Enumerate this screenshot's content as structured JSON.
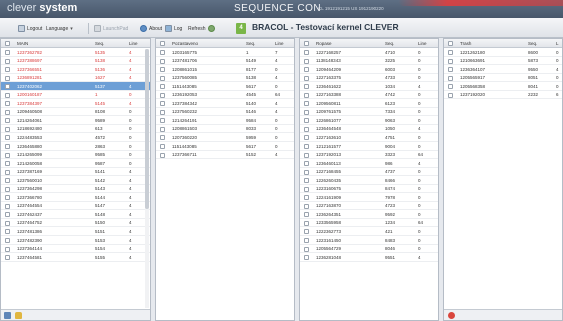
{
  "app": {
    "logo_part1": "clever",
    "logo_part2": "system",
    "title": "SEQUENCE CON",
    "ids": "CL 1912191215  US 1912190220"
  },
  "toolbar": {
    "logout": "Logout",
    "language": "Language",
    "launchpad": "LaunchPad",
    "about": "About",
    "log": "Log",
    "refresh": "Refresh",
    "counter": "4",
    "main_title": "BRACOL - Testovací kernel CLEVER"
  },
  "colors": {
    "accent_red": "#d83a3a",
    "selected": "#6d9fd6",
    "counter_green": "#7ab648"
  },
  "panels": {
    "main": {
      "headers": [
        "MAIN",
        "Seq.",
        "Line"
      ],
      "rows": [
        {
          "id": "1237362782",
          "seq": "5135",
          "line": "4",
          "state": "red"
        },
        {
          "id": "1237388697",
          "seq": "5138",
          "line": "4",
          "state": "red"
        },
        {
          "id": "1237366551",
          "seq": "5136",
          "line": "4",
          "state": "red"
        },
        {
          "id": "1236891281",
          "seq": "1627",
          "line": "4",
          "state": "red"
        },
        {
          "id": "1237402062",
          "seq": "5137",
          "line": "4",
          "state": "sel"
        },
        {
          "id": "1200160187",
          "seq": "1",
          "line": "0",
          "state": "red"
        },
        {
          "id": "1237384397",
          "seq": "5145",
          "line": "4",
          "state": "red"
        },
        {
          "id": "1209460508",
          "seq": "8108",
          "line": "0",
          "state": ""
        },
        {
          "id": "1214264061",
          "seq": "9589",
          "line": "0",
          "state": ""
        },
        {
          "id": "1218692480",
          "seq": "613",
          "line": "0",
          "state": ""
        },
        {
          "id": "1224483553",
          "seq": "4572",
          "line": "0",
          "state": ""
        },
        {
          "id": "1236465880",
          "seq": "2863",
          "line": "0",
          "state": ""
        },
        {
          "id": "1214265099",
          "seq": "9585",
          "line": "0",
          "state": ""
        },
        {
          "id": "1214260058",
          "seq": "9587",
          "line": "0",
          "state": ""
        },
        {
          "id": "1237387169",
          "seq": "5141",
          "line": "4",
          "state": ""
        },
        {
          "id": "1237560010",
          "seq": "5142",
          "line": "4",
          "state": ""
        },
        {
          "id": "1237364298",
          "seq": "5143",
          "line": "4",
          "state": ""
        },
        {
          "id": "1237366780",
          "seq": "5144",
          "line": "4",
          "state": ""
        },
        {
          "id": "1237464554",
          "seq": "5147",
          "line": "4",
          "state": ""
        },
        {
          "id": "1237462437",
          "seq": "5148",
          "line": "4",
          "state": ""
        },
        {
          "id": "1237464752",
          "seq": "5150",
          "line": "4",
          "state": ""
        },
        {
          "id": "1237481386",
          "seq": "5151",
          "line": "4",
          "state": ""
        },
        {
          "id": "1237482390",
          "seq": "5153",
          "line": "4",
          "state": ""
        },
        {
          "id": "1237364144",
          "seq": "5154",
          "line": "4",
          "state": ""
        },
        {
          "id": "1237464581",
          "seq": "5155",
          "line": "4",
          "state": ""
        }
      ]
    },
    "pozastaveno": {
      "headers": [
        "Pozastaveno",
        "Seq.",
        "Line"
      ],
      "rows": [
        {
          "id": "1203165775",
          "seq": "1",
          "line": "7"
        },
        {
          "id": "1237481706",
          "seq": "5149",
          "line": "4"
        },
        {
          "id": "1208861015",
          "seq": "8177",
          "line": "0"
        },
        {
          "id": "1237560085",
          "seq": "5138",
          "line": "4"
        },
        {
          "id": "1151443085",
          "seq": "5617",
          "line": "0"
        },
        {
          "id": "1236192053",
          "seq": "4545",
          "line": "64"
        },
        {
          "id": "1237384342",
          "seq": "5140",
          "line": "4"
        },
        {
          "id": "1237560232",
          "seq": "5146",
          "line": "4"
        },
        {
          "id": "1214264191",
          "seq": "9584",
          "line": "0"
        },
        {
          "id": "1208861503",
          "seq": "8033",
          "line": "0"
        },
        {
          "id": "1207360220",
          "seq": "5959",
          "line": "0"
        },
        {
          "id": "1151443085",
          "seq": "5617",
          "line": "0"
        },
        {
          "id": "1237366711",
          "seq": "5152",
          "line": "4"
        }
      ]
    },
    "ropase": {
      "headers": [
        "Ropase",
        "Seq.",
        "Line"
      ],
      "rows": [
        {
          "id": "1227168257",
          "seq": "4710",
          "line": "0"
        },
        {
          "id": "1138148343",
          "seq": "3225",
          "line": "0"
        },
        {
          "id": "1209464209",
          "seq": "6003",
          "line": "0"
        },
        {
          "id": "1227163375",
          "seq": "4733",
          "line": "0"
        },
        {
          "id": "1236461622",
          "seq": "1034",
          "line": "4"
        },
        {
          "id": "1227163388",
          "seq": "4742",
          "line": "0"
        },
        {
          "id": "1209560811",
          "seq": "6123",
          "line": "0"
        },
        {
          "id": "1209761575",
          "seq": "7334",
          "line": "0"
        },
        {
          "id": "1226861077",
          "seq": "9063",
          "line": "0"
        },
        {
          "id": "1236464548",
          "seq": "1050",
          "line": "4"
        },
        {
          "id": "1227163610",
          "seq": "4751",
          "line": "0"
        },
        {
          "id": "1212161577",
          "seq": "9004",
          "line": "0"
        },
        {
          "id": "1237192013",
          "seq": "3323",
          "line": "64"
        },
        {
          "id": "1236460113",
          "seq": "986",
          "line": "4"
        },
        {
          "id": "1227168455",
          "seq": "4737",
          "line": "0"
        },
        {
          "id": "1226260435",
          "seq": "8466",
          "line": "0"
        },
        {
          "id": "1223160675",
          "seq": "8474",
          "line": "0"
        },
        {
          "id": "1224161909",
          "seq": "7978",
          "line": "0"
        },
        {
          "id": "1227163870",
          "seq": "4723",
          "line": "0"
        },
        {
          "id": "1236264351",
          "seq": "9592",
          "line": "0"
        },
        {
          "id": "1233565958",
          "seq": "1234",
          "line": "64"
        },
        {
          "id": "1222362773",
          "seq": "421",
          "line": "0"
        },
        {
          "id": "1223161450",
          "seq": "8483",
          "line": "0"
        },
        {
          "id": "1205564729",
          "seq": "8046",
          "line": "0"
        },
        {
          "id": "1236281048",
          "seq": "9551",
          "line": "4"
        }
      ]
    },
    "trash": {
      "headers": [
        "Trash",
        "Seq.",
        "L"
      ],
      "rows": [
        {
          "id": "1221262180",
          "seq": "8600",
          "line": "0"
        },
        {
          "id": "1210663691",
          "seq": "5873",
          "line": "0"
        },
        {
          "id": "1236364107",
          "seq": "9550",
          "line": "4"
        },
        {
          "id": "1205565917",
          "seq": "8051",
          "line": "0"
        },
        {
          "id": "1205568358",
          "seq": "8041",
          "line": "0"
        },
        {
          "id": "1237192020",
          "seq": "2232",
          "line": "6"
        }
      ]
    }
  }
}
